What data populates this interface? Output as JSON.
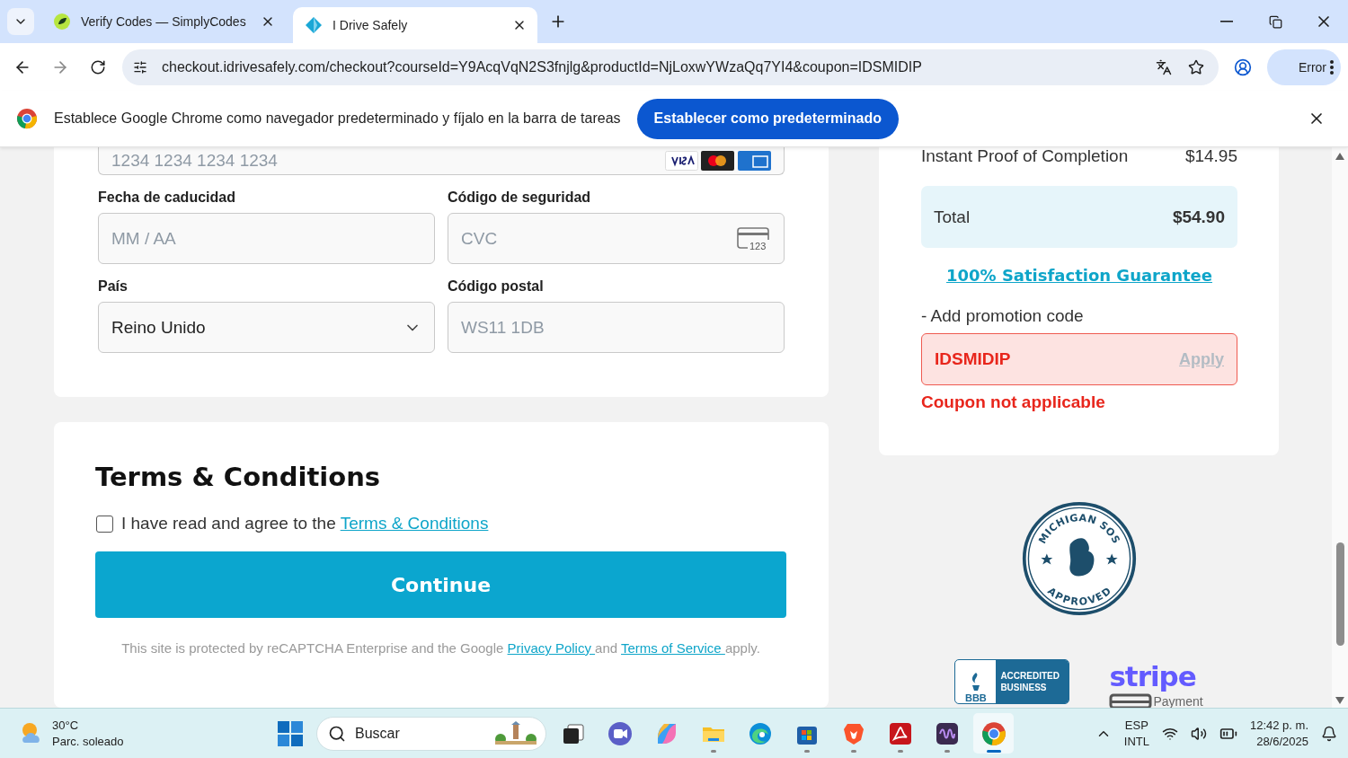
{
  "browser": {
    "tabs": [
      {
        "title": "Verify Codes — SimplyCodes",
        "selected": false
      },
      {
        "title": "I Drive Safely",
        "selected": true
      }
    ],
    "url": "checkout.idrivesafely.com/checkout?courseId=Y9AcqVqN2S3fnjlg&productId=NjLoxwYWzaQq7YI4&coupon=IDSMIDIP",
    "profile_label": "Error"
  },
  "infobar": {
    "message": "Establece Google Chrome como navegador predeterminado y fíjalo en la barra de tareas",
    "button": "Establecer como predeterminado"
  },
  "payment": {
    "card_number": {
      "placeholder": "1234 1234 1234 1234"
    },
    "fields": [
      {
        "label": "Fecha de caducidad",
        "kind": "input",
        "placeholder": "MM / AA"
      },
      {
        "label": "Código de seguridad",
        "kind": "cvc",
        "placeholder": "CVC",
        "icon_text": "123"
      },
      {
        "label": "País",
        "kind": "select",
        "value": "Reino Unido"
      },
      {
        "label": "Código postal",
        "kind": "input",
        "placeholder": "WS11 1DB"
      }
    ]
  },
  "terms": {
    "heading": "Terms & Conditions",
    "checked": false,
    "agree": [
      {
        "text": "I have read and agree to the ",
        "link": false
      },
      {
        "text": "Terms & Conditions",
        "link": true
      }
    ],
    "button": "Continue",
    "notice": [
      {
        "text": "This site is protected by reCAPTCHA Enterprise and the Google ",
        "link": false
      },
      {
        "text": "Privacy Policy ",
        "link": true
      },
      {
        "text": "and ",
        "link": false
      },
      {
        "text": "Terms of Service ",
        "link": true
      },
      {
        "text": "apply.",
        "link": false
      }
    ]
  },
  "summary": {
    "item": {
      "label": "Instant Proof of Completion",
      "price": "$14.95"
    },
    "total": {
      "label": "Total",
      "value": "$54.90"
    },
    "guarantee": "100% Satisfaction Guarantee",
    "promo_toggle": "- Add promotion code",
    "coupon": {
      "value": "IDSMIDIP",
      "invalid": true,
      "action": "Apply",
      "action_disabled": true,
      "error": "Coupon not applicable"
    }
  },
  "badges": {
    "seal_top": "MICHIGAN SOS",
    "seal_bottom": "APPROVED",
    "bbb": "BBB",
    "bbb_lines": [
      "ACCREDITED",
      "BUSINESS"
    ],
    "stripe": "stripe",
    "stripe_sub": "Payment"
  },
  "taskbar": {
    "weather": {
      "temp": "30°C",
      "condition": "Parc. soleado"
    },
    "search": "Buscar",
    "apps": [
      {
        "kind": "taskview",
        "running": false,
        "selected": false
      },
      {
        "kind": "chat",
        "running": false,
        "selected": false
      },
      {
        "kind": "copilot",
        "running": false,
        "selected": false
      },
      {
        "kind": "files",
        "running": true,
        "selected": false
      },
      {
        "kind": "edge",
        "running": false,
        "selected": false
      },
      {
        "kind": "store",
        "running": true,
        "selected": false
      },
      {
        "kind": "brave",
        "running": true,
        "selected": false
      },
      {
        "kind": "pdf",
        "running": true,
        "selected": false
      },
      {
        "kind": "media",
        "running": true,
        "selected": false
      },
      {
        "kind": "chrome",
        "running": true,
        "selected": true
      }
    ],
    "language": [
      "ESP",
      "INTL"
    ],
    "time": "12:42 p. m.",
    "date": "28/6/2025"
  }
}
